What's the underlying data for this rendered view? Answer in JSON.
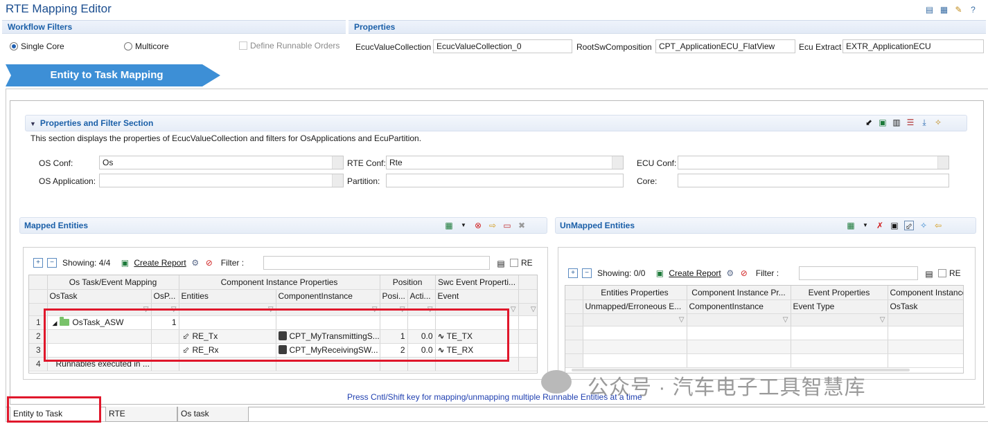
{
  "app": {
    "title": "RTE Mapping Editor"
  },
  "workflow": {
    "header": "Workflow Filters",
    "single_core": "Single Core",
    "multicore": "Multicore",
    "define_runnable": "Define Runnable Orders"
  },
  "properties": {
    "header": "Properties",
    "ecuc_label": "EcucValueCollection",
    "ecuc_value": "EcucValueCollection_0",
    "root_label": "RootSwComposition",
    "root_value": "CPT_ApplicationECU_FlatView",
    "extract_label": "Ecu Extract",
    "extract_value": "EXTR_ApplicationECU"
  },
  "banner": {
    "label": "Entity to Task Mapping"
  },
  "filter_section": {
    "title": "Properties and Filter Section",
    "description": "This section displays the properties of EcucValueCollection and filters for OsApplications and EcuPartition.",
    "os_conf_label": "OS Conf:",
    "os_conf_value": "Os",
    "rte_conf_label": "RTE Conf:",
    "rte_conf_value": "Rte",
    "ecu_conf_label": "ECU Conf:",
    "ecu_conf_value": "",
    "os_app_label": "OS Application:",
    "os_app_value": "",
    "partition_label": "Partition:",
    "partition_value": "",
    "core_label": "Core:",
    "core_value": ""
  },
  "mapped": {
    "title": "Mapped Entities",
    "showing": "Showing: 4/4",
    "create_report": "Create Report",
    "filter_label": "Filter :",
    "filter_value": "",
    "re_label": "RE",
    "groups": [
      "Os Task/Event Mapping",
      "Component Instance Properties",
      "Position",
      "Swc Event Properti..."
    ],
    "columns": [
      "OsTask",
      "OsP...",
      "Entities",
      "ComponentInstance",
      "Posi...",
      "Acti...",
      "Event"
    ],
    "rows": [
      {
        "num": "1",
        "task": "OsTask_ASW",
        "osp": "1",
        "entity": "",
        "comp": "",
        "pos": "",
        "act": "",
        "event": ""
      },
      {
        "num": "2",
        "task": "",
        "osp": "",
        "entity": "RE_Tx",
        "comp": "CPT_MyTransmittingS...",
        "pos": "1",
        "act": "0.0",
        "event": "TE_TX"
      },
      {
        "num": "3",
        "task": "",
        "osp": "",
        "entity": "RE_Rx",
        "comp": "CPT_MyReceivingSW...",
        "pos": "2",
        "act": "0.0",
        "event": "TE_RX"
      },
      {
        "num": "4",
        "task": "Runnables executed in ...",
        "osp": "",
        "entity": "",
        "comp": "",
        "pos": "",
        "act": "",
        "event": ""
      }
    ]
  },
  "unmapped": {
    "title": "UnMapped Entities",
    "showing": "Showing: 0/0",
    "create_report": "Create Report",
    "filter_label": "Filter :",
    "filter_value": "",
    "re_label": "RE",
    "groups": [
      "Entities Properties",
      "Component Instance Pr...",
      "Event Properties",
      "Component Instance"
    ],
    "columns": [
      "Unmapped/Erroneous E...",
      "ComponentInstance",
      "Event Type",
      "OsTask"
    ]
  },
  "hint": "Press Cntl/Shift key for mapping/unmapping multiple Runnable Entities at a time",
  "tabs": [
    "Entity to Task Mapping",
    "RTE Configuration",
    "Os task Properties"
  ],
  "watermark": "公众号 · 汽车电子工具智慧库",
  "colors": {
    "accent": "#1a5fa8",
    "banner": "#3d8fd6",
    "highlight": "#e0172b"
  }
}
